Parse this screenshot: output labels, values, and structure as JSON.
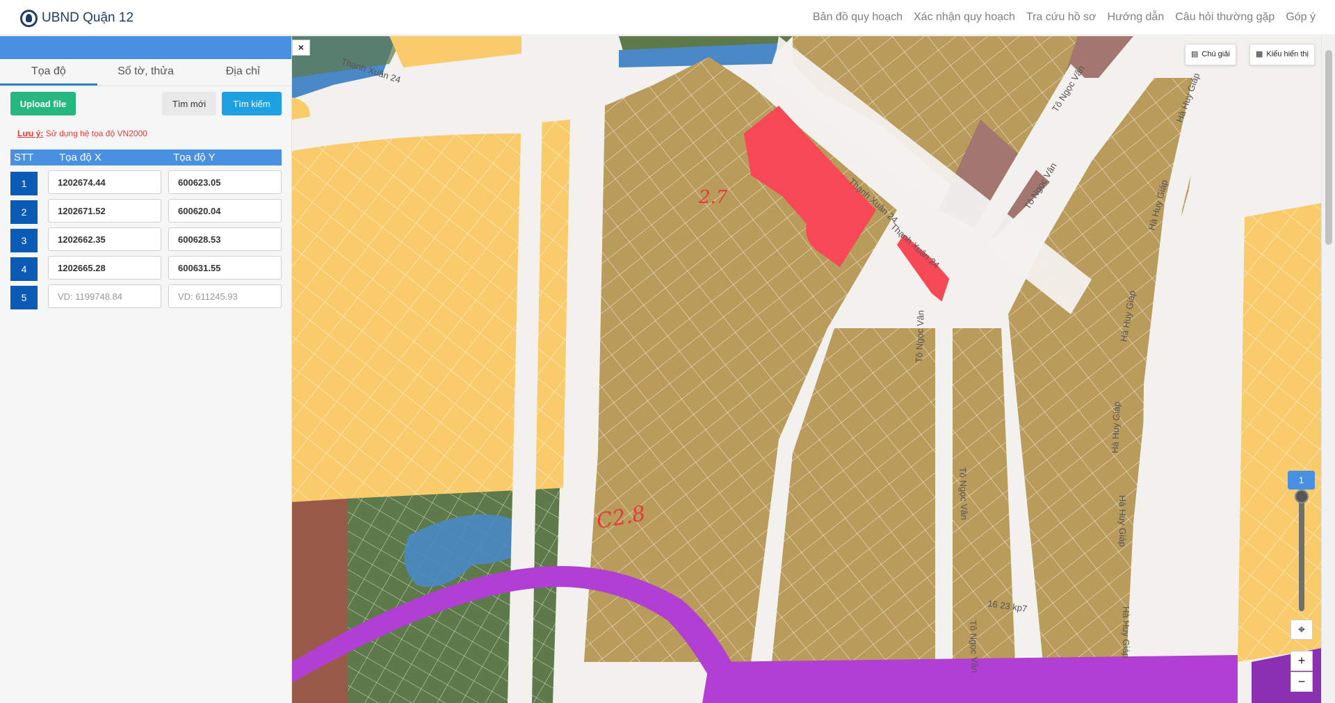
{
  "header": {
    "title": "UBND Quận 12",
    "nav": [
      "Bản đồ quy hoạch",
      "Xác nhận quy hoạch",
      "Tra cứu hồ sơ",
      "Hướng dẫn",
      "Câu hỏi thường gặp",
      "Góp ý"
    ]
  },
  "sidebar": {
    "tabs": [
      "Tọa độ",
      "Số tờ, thửa",
      "Địa chỉ"
    ],
    "active_tab": "Tọa độ",
    "upload_label": "Upload file",
    "new_label": "Tìm mới",
    "search_label": "Tìm kiếm",
    "note_prefix": "Lưu ý:",
    "note_text": " Sử dụng hệ tọa độ VN2000",
    "table": {
      "headers": [
        "STT",
        "Tọa độ X",
        "Tọa độ Y"
      ],
      "rows": [
        {
          "stt": "1",
          "x": "1202674.44",
          "y": "600623.05"
        },
        {
          "stt": "2",
          "x": "1202671.52",
          "y": "600620.04"
        },
        {
          "stt": "3",
          "x": "1202662.35",
          "y": "600628.53"
        },
        {
          "stt": "4",
          "x": "1202665.28",
          "y": "600631.55"
        },
        {
          "stt": "5",
          "x": "",
          "y": "",
          "x_placeholder": "VD: 1199748.84",
          "y_placeholder": "VD: 611245.93"
        }
      ]
    }
  },
  "map": {
    "close_label": "×",
    "legend_label": "Chú giải",
    "display_label": "Kiểu hiển thị",
    "zoom_level": "1",
    "zoom_in": "+",
    "zoom_out": "−",
    "roads": {
      "thanh_xuan_24": "Thạnh Xuân 24",
      "to_ngoc_van": "Tô Ngọc Vân",
      "ha_huy_giap": "Hà Huy Giáp",
      "kp7": "16 23 kp7"
    },
    "annotations": [
      "2.7",
      "C2.8"
    ],
    "colors": {
      "residential": "#f9cb6b",
      "mixed": "#b99b5b",
      "highlight": "#f74856",
      "green": "#5e7a4a",
      "water": "#4a88c7",
      "transit": "#b13fd4",
      "public": "#a3766f"
    }
  }
}
